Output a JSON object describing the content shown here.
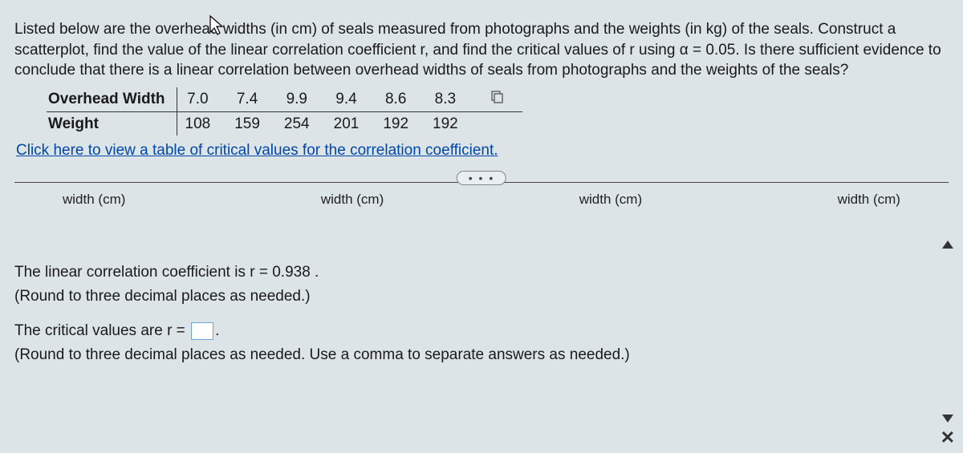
{
  "problem": {
    "line1": "Listed below are the overhead widths (in cm) of seals measured from photographs and the weights (in kg) of the seals.",
    "line2": "Construct a scatterplot, find the value of the linear correlation coefficient r, and find the critical values of r using",
    "line3": "α = 0.05. Is there sufficient evidence to conclude that there is a linear correlation between overhead widths of seals",
    "line4": "from photographs and the weights of the seals?"
  },
  "table": {
    "row1_label": "Overhead Width",
    "row2_label": "Weight",
    "overhead": [
      "7.0",
      "7.4",
      "9.9",
      "9.4",
      "8.6",
      "8.3"
    ],
    "weight": [
      "108",
      "159",
      "254",
      "201",
      "192",
      "192"
    ]
  },
  "link_text": "Click here to view a table of critical values for the correlation coefficient.",
  "dots": "• • •",
  "axis_label": "width (cm)",
  "answer1": {
    "text_pre": "The linear correlation coefficient is r = ",
    "value": "0.938",
    "text_post": " .",
    "note": "(Round to three decimal places as needed.)"
  },
  "answer2": {
    "text_pre": "The critical values are r = ",
    "text_post": ".",
    "note": "(Round to three decimal places as needed. Use a comma to separate answers as needed.)"
  },
  "close": "✕"
}
